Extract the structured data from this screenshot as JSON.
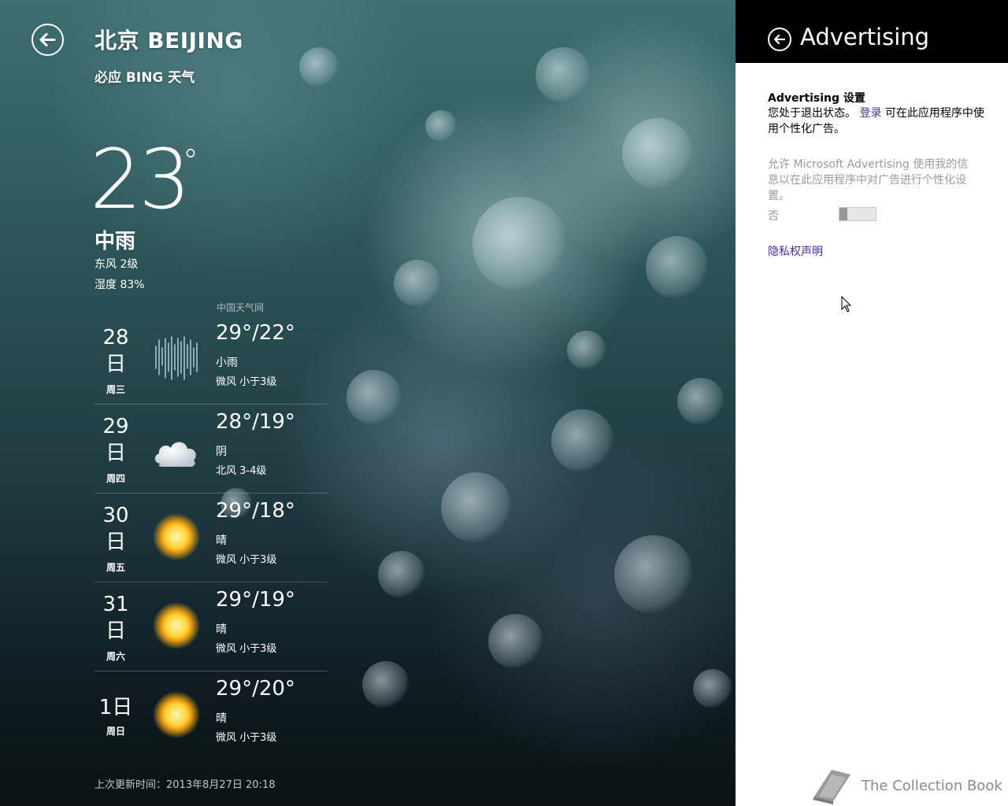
{
  "weather": {
    "city": "北京 BEIJING",
    "app_name": "必应 BING 天气",
    "current": {
      "temperature": "23",
      "degree_symbol": "°",
      "condition": "中雨",
      "wind": "东风 2级",
      "humidity": "湿度 83%"
    },
    "forecast_source": "中国天气网",
    "forecast": [
      {
        "date_line1": "28",
        "date_line2": "日",
        "weekday": "周三",
        "icon": "light-rain-icon",
        "temp": "29°/22°",
        "condition": "小雨",
        "wind": "微风 小于3级"
      },
      {
        "date_line1": "29",
        "date_line2": "日",
        "weekday": "周四",
        "icon": "cloudy-icon",
        "temp": "28°/19°",
        "condition": "阴",
        "wind": "北风 3-4级"
      },
      {
        "date_line1": "30",
        "date_line2": "日",
        "weekday": "周五",
        "icon": "sunny-icon",
        "temp": "29°/18°",
        "condition": "晴",
        "wind": "微风 小于3级"
      },
      {
        "date_line1": "31",
        "date_line2": "日",
        "weekday": "周六",
        "icon": "sunny-icon",
        "temp": "29°/19°",
        "condition": "晴",
        "wind": "微风 小于3级"
      },
      {
        "date_line1": "1日",
        "date_line2": "",
        "weekday": "周日",
        "icon": "sunny-icon",
        "temp": "29°/20°",
        "condition": "晴",
        "wind": "微风 小于3级"
      }
    ],
    "last_updated": "上次更新时间：2013年8月27日 20:18"
  },
  "flyout": {
    "title": "Advertising",
    "settings_heading": "Advertising 设置",
    "status_prefix": "您处于退出状态。",
    "signin_link": "登录",
    "status_suffix": "可在此应用程序中使用个性化广告。",
    "allow_text": "允许 Microsoft Advertising 使用我的信息以在此应用程序中对广告进行个性化设置。",
    "toggle_state": "否",
    "toggle_value": false,
    "privacy_link": "隐私权声明"
  },
  "watermark": {
    "text": "The Collection Book"
  },
  "colors": {
    "flyout_header_bg": "#000000",
    "link": "#4b2c9c",
    "disabled_text": "#9a9a9a"
  }
}
